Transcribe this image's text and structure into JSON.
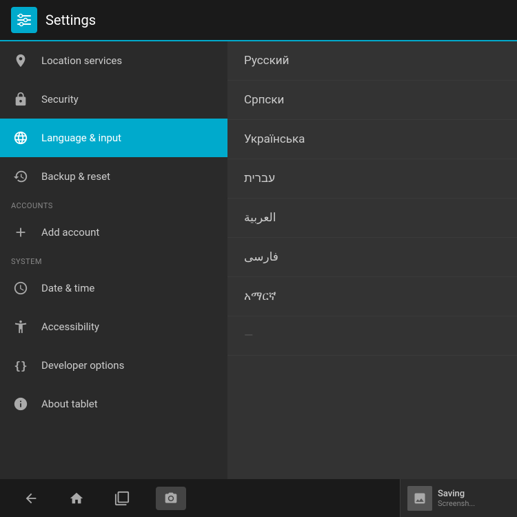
{
  "header": {
    "title": "Settings",
    "icon_label": "settings-icon"
  },
  "sidebar": {
    "items": [
      {
        "id": "location",
        "label": "Location services",
        "icon": "📍",
        "icon_name": "location-icon",
        "active": false,
        "section": null
      },
      {
        "id": "security",
        "label": "Security",
        "icon": "🔒",
        "icon_name": "security-icon",
        "active": false,
        "section": null
      },
      {
        "id": "language",
        "label": "Language & input",
        "icon": "A",
        "icon_name": "language-icon",
        "active": true,
        "section": null
      },
      {
        "id": "backup",
        "label": "Backup & reset",
        "icon": "↩",
        "icon_name": "backup-icon",
        "active": false,
        "section": null
      }
    ],
    "sections": [
      {
        "label": "ACCOUNTS",
        "label_id": "accounts-section",
        "items": [
          {
            "id": "add-account",
            "label": "Add account",
            "icon": "+",
            "icon_name": "add-account-icon",
            "active": false
          }
        ]
      },
      {
        "label": "SYSTEM",
        "label_id": "system-section",
        "items": [
          {
            "id": "datetime",
            "label": "Date & time",
            "icon": "⊙",
            "icon_name": "datetime-icon",
            "active": false
          },
          {
            "id": "accessibility",
            "label": "Accessibility",
            "icon": "✋",
            "icon_name": "accessibility-icon",
            "active": false
          },
          {
            "id": "developer",
            "label": "Developer options",
            "icon": "{}",
            "icon_name": "developer-icon",
            "active": false
          },
          {
            "id": "about",
            "label": "About tablet",
            "icon": "ℹ",
            "icon_name": "about-icon",
            "active": false
          }
        ]
      }
    ]
  },
  "right_panel": {
    "languages": [
      {
        "name": "Русский"
      },
      {
        "name": "Српски"
      },
      {
        "name": "Українська"
      },
      {
        "name": "עברית"
      },
      {
        "name": "العربية"
      },
      {
        "name": "فارسی"
      },
      {
        "name": "አማርኛ"
      },
      {
        "name": "..."
      }
    ]
  },
  "nav_bar": {
    "back_label": "back-button",
    "home_label": "home-button",
    "recents_label": "recents-button",
    "camera_label": "screenshot-camera-button"
  },
  "screenshot_notification": {
    "title": "Saving",
    "subtitle": "Screensh..."
  }
}
